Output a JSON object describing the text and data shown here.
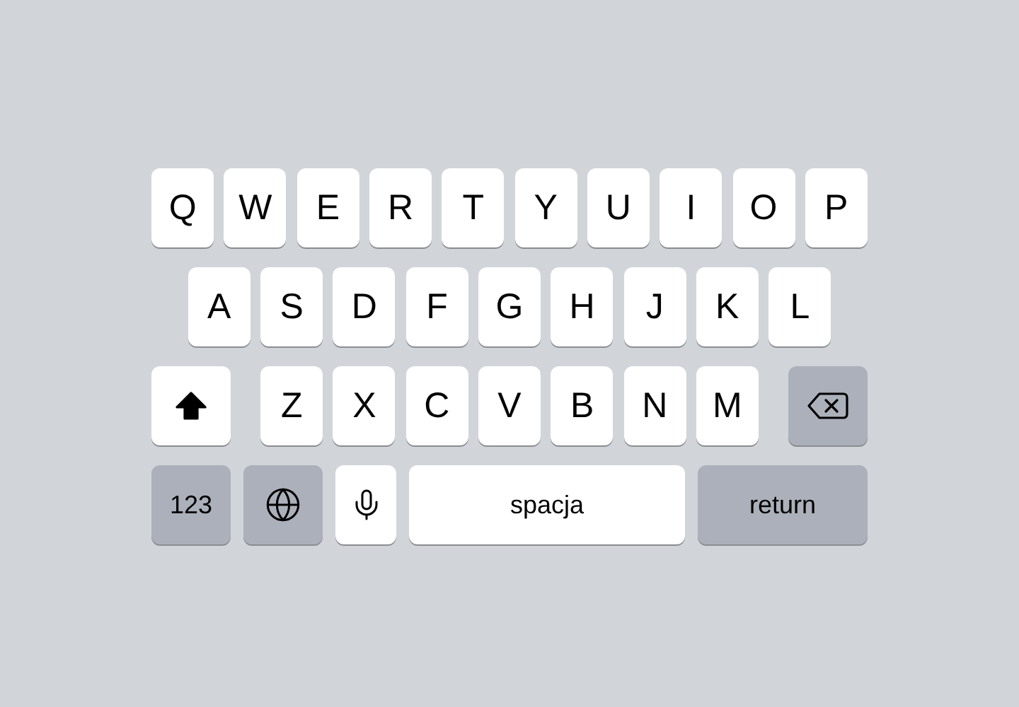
{
  "keyboard": {
    "rows": [
      {
        "kind": "letters",
        "keys": [
          {
            "kind": "letter",
            "label": "Q"
          },
          {
            "kind": "letter",
            "label": "W"
          },
          {
            "kind": "letter",
            "label": "E"
          },
          {
            "kind": "letter",
            "label": "R"
          },
          {
            "kind": "letter",
            "label": "T"
          },
          {
            "kind": "letter",
            "label": "Y"
          },
          {
            "kind": "letter",
            "label": "U"
          },
          {
            "kind": "letter",
            "label": "I"
          },
          {
            "kind": "letter",
            "label": "O"
          },
          {
            "kind": "letter",
            "label": "P"
          }
        ]
      },
      {
        "kind": "letters",
        "keys": [
          {
            "kind": "letter",
            "label": "A"
          },
          {
            "kind": "letter",
            "label": "S"
          },
          {
            "kind": "letter",
            "label": "D"
          },
          {
            "kind": "letter",
            "label": "F"
          },
          {
            "kind": "letter",
            "label": "G"
          },
          {
            "kind": "letter",
            "label": "H"
          },
          {
            "kind": "letter",
            "label": "J"
          },
          {
            "kind": "letter",
            "label": "K"
          },
          {
            "kind": "letter",
            "label": "L"
          }
        ]
      },
      {
        "kind": "shiftrow",
        "keys": [
          {
            "kind": "shift",
            "on": true
          },
          {
            "kind": "letter",
            "label": "Z"
          },
          {
            "kind": "letter",
            "label": "X"
          },
          {
            "kind": "letter",
            "label": "C"
          },
          {
            "kind": "letter",
            "label": "V"
          },
          {
            "kind": "letter",
            "label": "B"
          },
          {
            "kind": "letter",
            "label": "N"
          },
          {
            "kind": "letter",
            "label": "M"
          },
          {
            "kind": "delete"
          }
        ]
      },
      {
        "kind": "bottom",
        "keys": [
          {
            "kind": "mode",
            "label": "123"
          },
          {
            "kind": "globe"
          },
          {
            "kind": "mic"
          },
          {
            "kind": "space",
            "label": "spacja"
          },
          {
            "kind": "return",
            "label": "return"
          }
        ]
      }
    ]
  }
}
